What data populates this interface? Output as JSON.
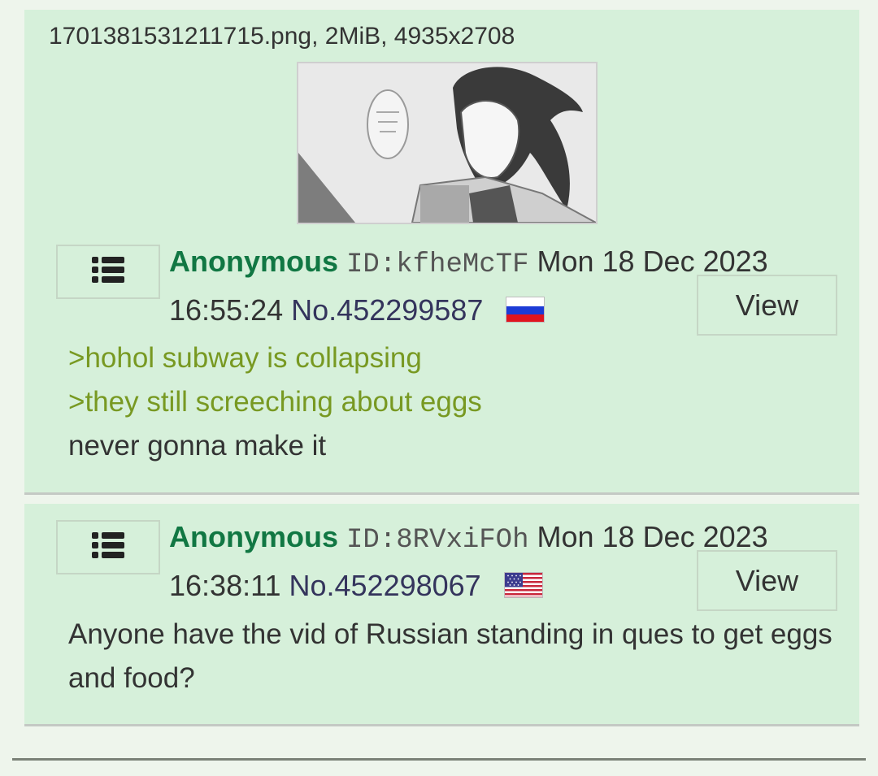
{
  "posts": [
    {
      "file": {
        "info": "1701381531211715.png, 2MiB, 4935x2708"
      },
      "name": "Anonymous",
      "id": "ID:kfheMcTF",
      "datetime": "Mon 18 Dec 2023 16:55:24",
      "number": "No.452299587",
      "flag_icon": "russia-flag-icon",
      "view_label": "View",
      "menu_icon": "list-menu-icon",
      "comment_lines": [
        ">hohol subway is collapsing",
        ">they still screeching about eggs",
        "never gonna make it"
      ]
    },
    {
      "name": "Anonymous",
      "id": "ID:8RVxiFOh",
      "datetime": "Mon 18 Dec 2023 16:38:11",
      "number": "No.452298067",
      "flag_icon": "usa-flag-icon",
      "view_label": "View",
      "menu_icon": "list-menu-icon",
      "comment": "Anyone have the vid of Russian standing in ques to get eggs and food?"
    }
  ],
  "colors": {
    "post_background": "#d6f0da",
    "page_background": "#eef5ec",
    "name": "#117743",
    "greentext": "#789922",
    "post_number": "#34345c"
  }
}
